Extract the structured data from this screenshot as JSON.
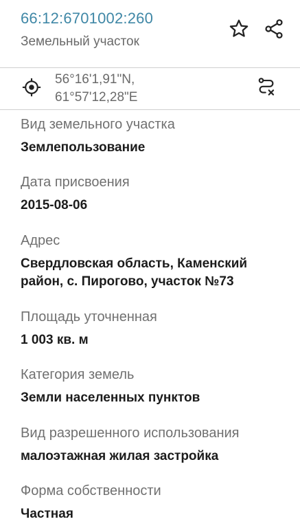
{
  "header": {
    "cadastral_number": "66:12:6701002:260",
    "object_type": "Земельный участок"
  },
  "coordinates": {
    "lat": "56°16'1,91\"N,",
    "lon": "61°57'12,28\"E"
  },
  "fields": [
    {
      "label": "Вид земельного участка",
      "value": "Землепользование"
    },
    {
      "label": "Дата присвоения",
      "value": "2015-08-06"
    },
    {
      "label": "Адрес",
      "value_line1": "Свердловская область, Каменский",
      "value_line2": "район, с. Пирогово, участок №73"
    },
    {
      "label": "Площадь уточненная",
      "value": "1 003 кв. м"
    },
    {
      "label": "Категория земель",
      "value": "Земли населенных пунктов"
    },
    {
      "label": "Вид разрешенного использования",
      "value": "малоэтажная жилая застройка"
    },
    {
      "label": "Форма собственности",
      "value": "Частная"
    }
  ],
  "icons": {
    "favorite": "star-outline-icon",
    "share": "share-icon",
    "locate": "crosshair-target-icon",
    "route": "route-cancel-icon"
  },
  "colors": {
    "cadastral_number": "#3f87a6",
    "secondary_text": "#6a6a6a",
    "primary_text": "#1c1c1c",
    "divider": "#cfcfcf"
  }
}
